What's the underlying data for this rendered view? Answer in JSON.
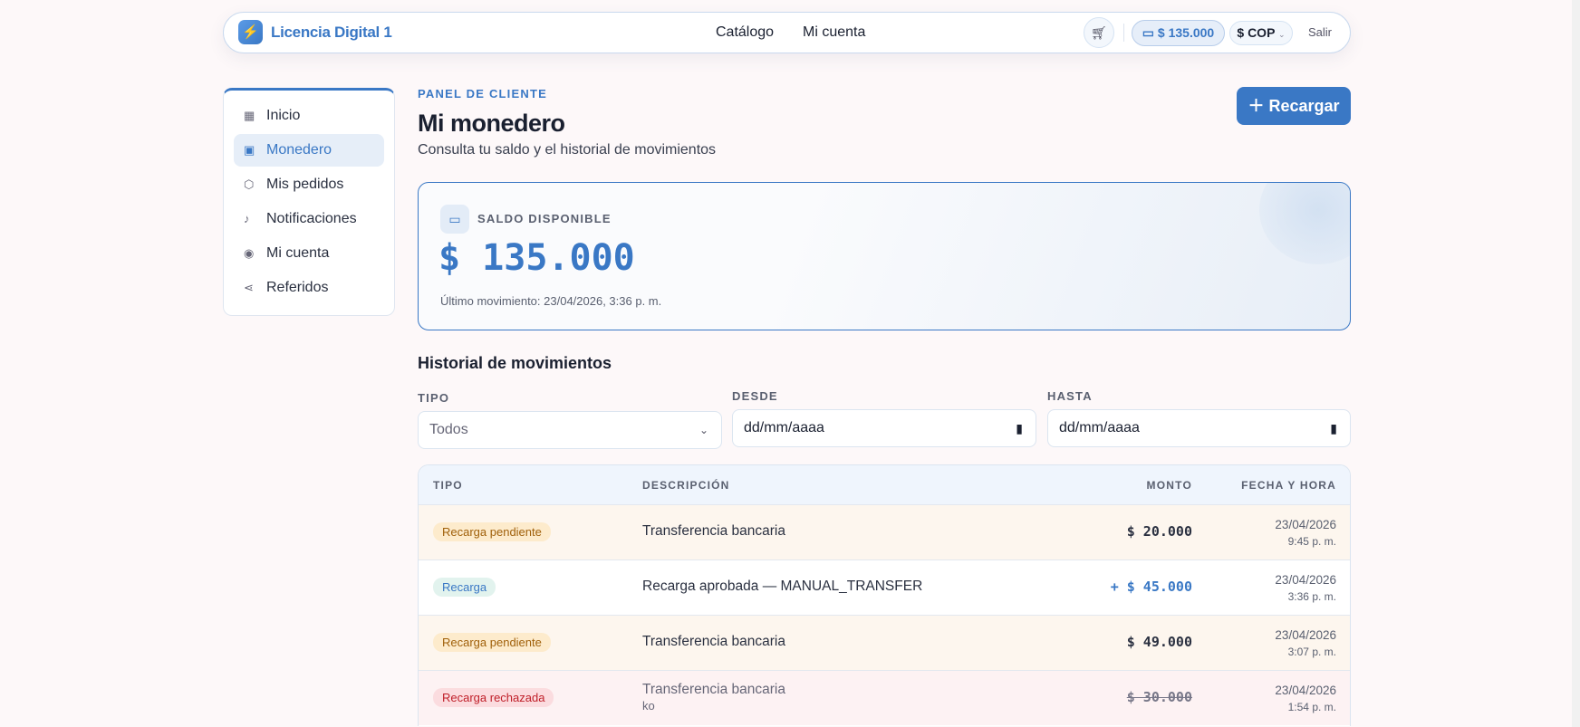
{
  "header": {
    "brand": "Licencia Digital 1",
    "nav": [
      "Catálogo",
      "Mi cuenta"
    ],
    "balance": "$ 135.000",
    "currency": "$ COP",
    "logout": "Salir"
  },
  "sidebar": {
    "items": [
      {
        "label": "Inicio",
        "icon": "grid-icon"
      },
      {
        "label": "Monedero",
        "icon": "wallet-icon",
        "active": true
      },
      {
        "label": "Mis pedidos",
        "icon": "box-icon"
      },
      {
        "label": "Notificaciones",
        "icon": "bell-icon"
      },
      {
        "label": "Mi cuenta",
        "icon": "user-circle-icon"
      },
      {
        "label": "Referidos",
        "icon": "share-icon"
      }
    ]
  },
  "page": {
    "eyebrow": "PANEL DE CLIENTE",
    "title": "Mi monedero",
    "subtitle": "Consulta tu saldo y el historial de movimientos",
    "recharge": "Recargar"
  },
  "balance_card": {
    "label": "SALDO DISPONIBLE",
    "amount": "$ 135.000",
    "last": "Último movimiento: 23/04/2026, 3:36 p. m."
  },
  "history": {
    "title": "Historial de movimientos",
    "filters": {
      "type_label": "TIPO",
      "type_value": "Todos",
      "from_label": "DESDE",
      "from_value": "dd/mm/aaaa",
      "to_label": "HASTA",
      "to_value": "dd/mm/aaaa"
    },
    "columns": [
      "TIPO",
      "DESCRIPCIÓN",
      "MONTO",
      "FECHA Y HORA"
    ],
    "rows": [
      {
        "type": "Recarga pendiente",
        "desc": "Transferencia bancaria",
        "note": "",
        "amount": "$ 20.000",
        "date": "23/04/2026",
        "time": "9:45 p. m."
      },
      {
        "type": "Recarga",
        "desc": "Recarga aprobada — MANUAL_TRANSFER",
        "note": "",
        "amount": "+ $ 45.000",
        "date": "23/04/2026",
        "time": "3:36 p. m."
      },
      {
        "type": "Recarga pendiente",
        "desc": "Transferencia bancaria",
        "note": "",
        "amount": "$ 49.000",
        "date": "23/04/2026",
        "time": "3:07 p. m."
      },
      {
        "type": "Recarga rechazada",
        "desc": "Transferencia bancaria",
        "note": "ko",
        "amount": "$ 30.000",
        "date": "23/04/2026",
        "time": "1:54 p. m."
      }
    ]
  },
  "colors": {
    "accent": "#3a78c5",
    "pending_bg": "#fdf6ee",
    "rejected_bg": "#fdf2f3"
  }
}
